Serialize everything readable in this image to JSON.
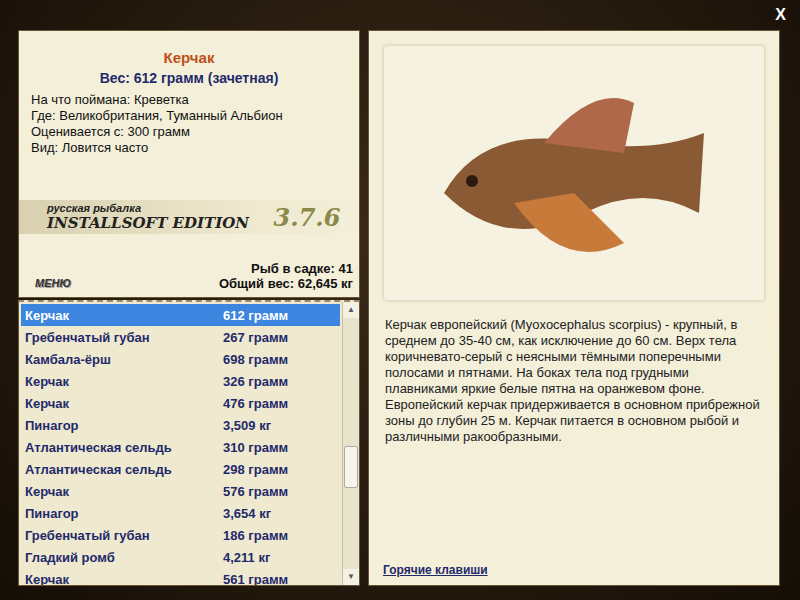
{
  "window": {
    "close": "X"
  },
  "fish": {
    "title": "Керчак",
    "weight": "Вес: 612 грамм (зачетная)",
    "fields": [
      "На что поймана: Креветка",
      "Где: Великобритания, Туманный Альбион",
      "Оценивается с: 300 грамм",
      "Вид: Ловится часто"
    ]
  },
  "logo": {
    "top": "русская рыбалка",
    "edition": "INSTALLSOFT EDITION",
    "version": "3.7.6"
  },
  "stats": {
    "count": "Рыб в садке: 41",
    "total": "Общий вес: 62,645 кг"
  },
  "menu_button": "МЕНЮ",
  "catch_list": [
    {
      "name": "Керчак",
      "weight": "612 грамм",
      "selected": true
    },
    {
      "name": "Гребенчатый губан",
      "weight": "267 грамм",
      "selected": false
    },
    {
      "name": "Камбала-ёрш",
      "weight": "698 грамм",
      "selected": false
    },
    {
      "name": "Керчак",
      "weight": "326 грамм",
      "selected": false
    },
    {
      "name": "Керчак",
      "weight": "476 грамм",
      "selected": false
    },
    {
      "name": "Пинагор",
      "weight": "3,509 кг",
      "selected": false
    },
    {
      "name": "Атлантическая сельдь",
      "weight": "310 грамм",
      "selected": false
    },
    {
      "name": "Атлантическая сельдь",
      "weight": "298 грамм",
      "selected": false
    },
    {
      "name": "Керчак",
      "weight": "576 грамм",
      "selected": false
    },
    {
      "name": "Пинагор",
      "weight": "3,654 кг",
      "selected": false
    },
    {
      "name": "Гребенчатый губан",
      "weight": "186 грамм",
      "selected": false
    },
    {
      "name": "Гладкий ромб",
      "weight": "4,211 кг",
      "selected": false
    },
    {
      "name": "Керчак",
      "weight": "561 грамм",
      "selected": false
    }
  ],
  "scrollbar": {
    "up": "▲",
    "down": "▼",
    "level": 0.6
  },
  "description": "Керчак европейский (Myoxocephalus scorpius) - крупный, в среднем до 35-40 см, как исключение до 60 см. Верх тела коричневато-серый с неясными тёмными поперечными полосами и пятнами. На боках тела под грудными плавниками яркие белые пятна на оранжевом фоне. Европейский керчак придерживается в основном прибрежной зоны до глубин 25 м. Керчак питается в основном рыбой и различными ракообразными.",
  "hotkeys_link": "Горячие клавиши"
}
